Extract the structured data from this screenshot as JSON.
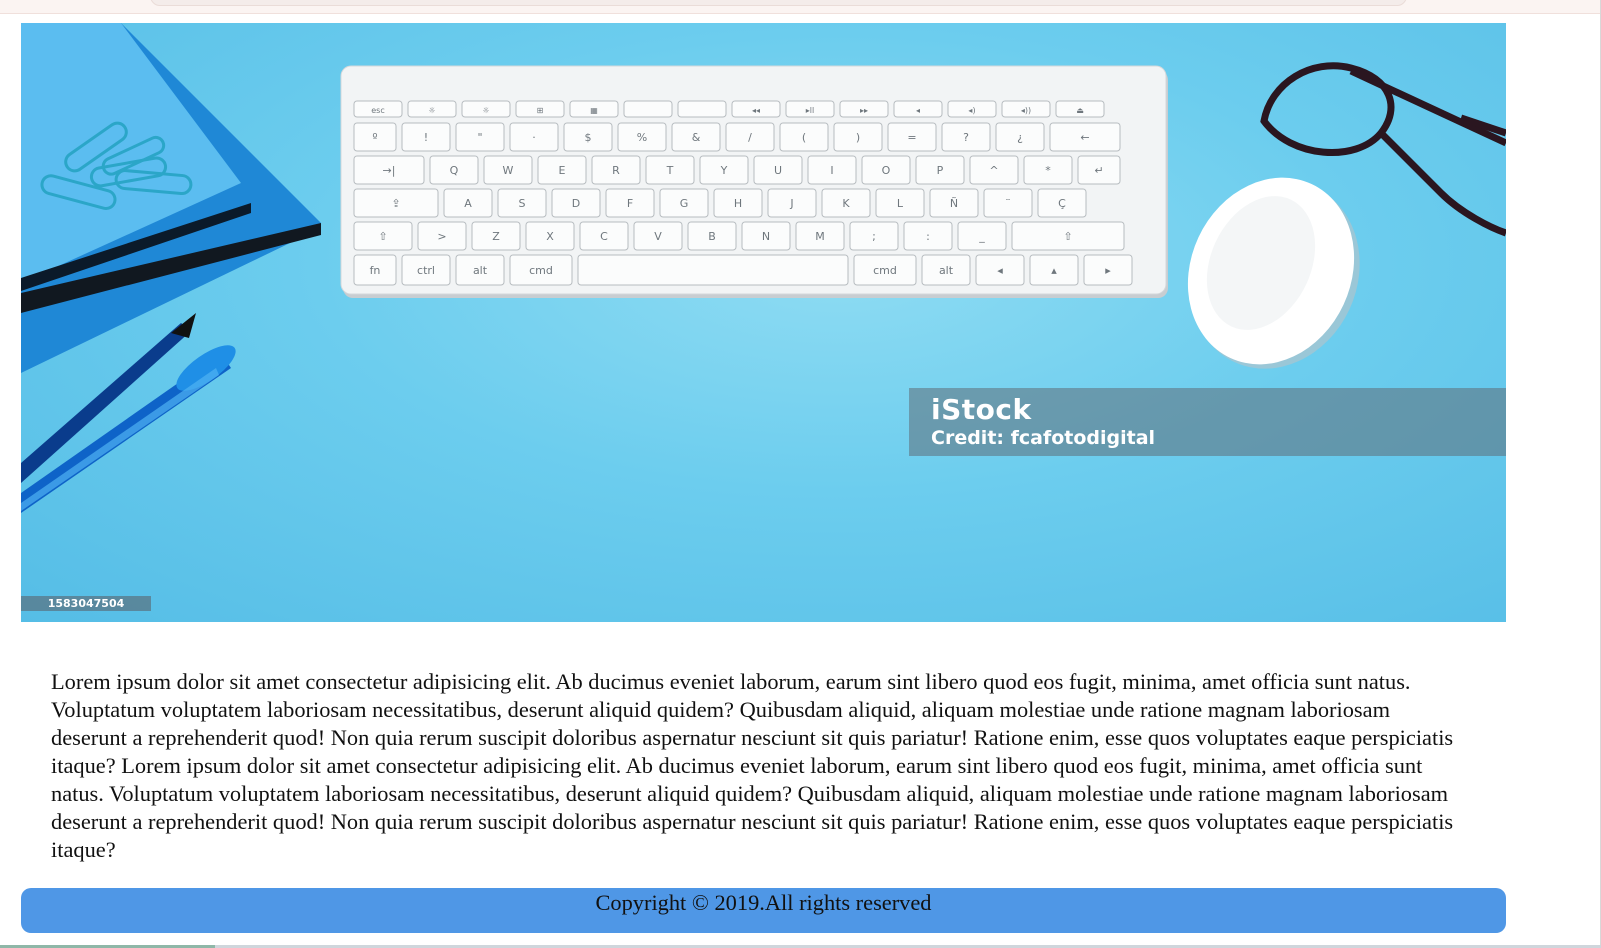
{
  "hero": {
    "watermark_brand": "iStock",
    "watermark_credit": "Credit: fcafotodigital",
    "image_id": "1583047504",
    "keyboard_keys": {
      "row1": [
        "esc",
        "☼",
        "☼",
        "⊞",
        "▦",
        "",
        "",
        "◂◂",
        "▸ll",
        "▸▸",
        "◂",
        "◂)",
        "◂))",
        "⏏"
      ],
      "row2": [
        "º",
        "!",
        "\"",
        "·",
        "$",
        "%",
        "&",
        "/",
        "(",
        ")",
        "=",
        "?",
        "¿",
        "←"
      ],
      "row3": [
        "→|",
        "Q",
        "W",
        "E",
        "R",
        "T",
        "Y",
        "U",
        "I",
        "O",
        "P",
        "^",
        "*",
        "↵"
      ],
      "row4": [
        "⇪",
        "A",
        "S",
        "D",
        "F",
        "G",
        "H",
        "J",
        "K",
        "L",
        "Ñ",
        "¨",
        "Ç"
      ],
      "row5": [
        "⇧",
        ">",
        "Z",
        "X",
        "C",
        "V",
        "B",
        "N",
        "M",
        ";",
        ":",
        "_",
        "⇧"
      ],
      "row6": [
        "fn",
        "ctrl",
        "alt",
        "cmd",
        "",
        "cmd",
        "alt",
        "◂",
        "▴",
        "▸"
      ]
    }
  },
  "content": {
    "paragraph": "Lorem ipsum dolor sit amet consectetur adipisicing elit. Ab ducimus eveniet laborum, earum sint libero quod eos fugit, minima, amet officia sunt natus. Voluptatum voluptatem laboriosam necessitatibus, deserunt aliquid quidem? Quibusdam aliquid, aliquam molestiae unde ratione magnam laboriosam deserunt a reprehenderit quod! Non quia rerum suscipit doloribus aspernatur nesciunt sit quis pariatur! Ratione enim, esse quos voluptates eaque perspiciatis itaque? Lorem ipsum dolor sit amet consectetur adipisicing elit. Ab ducimus eveniet laborum, earum sint libero quod eos fugit, minima, amet officia sunt natus. Voluptatum voluptatem laboriosam necessitatibus, deserunt aliquid quidem? Quibusdam aliquid, aliquam molestiae unde ratione magnam laboriosam deserunt a reprehenderit quod! Non quia rerum suscipit doloribus aspernatur nesciunt sit quis pariatur! Ratione enim, esse quos voluptates eaque perspiciatis itaque?"
  },
  "footer": {
    "copyright": "Copyright © 2019.All rights reserved"
  },
  "colors": {
    "footer_bg": "#4f97e6",
    "hero_bg": "#6ccdee"
  }
}
